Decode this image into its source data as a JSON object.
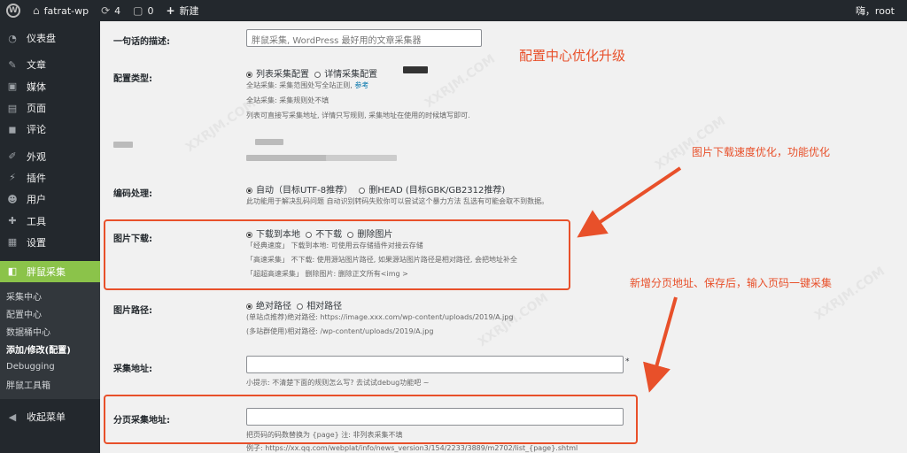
{
  "adminbar": {
    "site_name": "fatrat-wp",
    "updates_count": "4",
    "comments_count": "0",
    "new_label": "新建",
    "greeting": "嗨，root"
  },
  "sidebar": {
    "items": [
      {
        "label": "仪表盘",
        "icon": "dashboard-icon"
      },
      {
        "label": "文章",
        "icon": "pin-icon"
      },
      {
        "label": "媒体",
        "icon": "media-icon"
      },
      {
        "label": "页面",
        "icon": "page-icon"
      },
      {
        "label": "评论",
        "icon": "comment-icon"
      },
      {
        "label": "外观",
        "icon": "brush-icon"
      },
      {
        "label": "插件",
        "icon": "plugin-icon"
      },
      {
        "label": "用户",
        "icon": "user-icon"
      },
      {
        "label": "工具",
        "icon": "wrench-icon"
      },
      {
        "label": "设置",
        "icon": "settings-icon"
      }
    ],
    "active": {
      "label": "胖鼠采集",
      "icon": "fatrat-icon"
    },
    "submenu": [
      "采集中心",
      "配置中心",
      "数据桶中心",
      "添加/修改(配置)",
      "Debugging",
      "胖鼠工具箱"
    ],
    "collapse_label": "收起菜单"
  },
  "form": {
    "desc_label": "一句话的描述:",
    "desc_value": "胖鼠采集, WordPress 最好用的文章采集器",
    "type_label": "配置类型:",
    "type_options": [
      "列表采集配置",
      "详情采集配置"
    ],
    "type_help1": "全站采集: 采集范围处写全站正则,",
    "type_help1_link": "参考",
    "type_help2": "全站采集: 采集规则处不填",
    "type_help3": "列表可直接写采集地址, 详情只写规则, 采集地址在使用的时候填写即可.",
    "encoding_label": "编码处理:",
    "encoding_options": [
      "自动（目标UTF-8推荐）",
      "删HEAD (目标GBK/GB2312推荐)"
    ],
    "encoding_help": "此功能用于解决乱码问题 自动识别转码失败你可以尝试这个暴力方法 乱选有可能会取不到数据。",
    "image_label": "图片下载:",
    "image_options": [
      "下载到本地",
      "不下载",
      "删除图片"
    ],
    "image_help1": "「经典速度」 下载到本地: 可使用云存储插件对接云存储",
    "image_help2": "「高速采集」 不下载: 使用源站图片路径, 如果源站图片路径是相对路径, 会把地址补全",
    "image_help3": "「超超高速采集」 删除图片: 删除正文所有<img >",
    "path_label": "图片路径:",
    "path_options": [
      "绝对路径",
      "相对路径"
    ],
    "path_help1": "(单站点推荐)绝对路径: https://image.xxx.com/wp-content/uploads/2019/A.jpg",
    "path_help2": "(多站群使用)相对路径: /wp-content/uploads/2019/A.jpg",
    "url_label": "采集地址:",
    "url_required": "*",
    "url_help": "小提示: 不清楚下面的规则怎么写? 去试试debug功能吧 ~",
    "paging_label": "分页采集地址:",
    "paging_help": "把页码的码数替换为 {page} 注: 非列表采集不填",
    "paging_example": "例子: https://xx.qq.com/webplat/info/news_version3/154/2233/3889/m2702/list_{page}.shtml"
  },
  "annotations": {
    "title": "配置中心优化升级",
    "image_note": "图片下载速度优化，功能优化",
    "paging_note": "新增分页地址、保存后，输入页码一键采集"
  },
  "watermark": "XXRJM.COM",
  "colors": {
    "accent": "#8bc34a",
    "annotation": "#e8502a",
    "adminbar": "#23282d"
  }
}
